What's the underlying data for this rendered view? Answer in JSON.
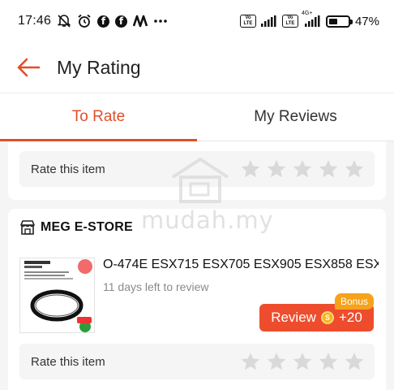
{
  "status_bar": {
    "time": "17:46",
    "battery_pct": "47%",
    "battery_level": 0.47,
    "network_label_1": "Vo LTE",
    "network_label_2": "Vo LTE",
    "network_type": "4G+",
    "icons": [
      "mute-icon",
      "alarm-icon",
      "facebook-icon",
      "facebook-icon",
      "app-icon",
      "more-dots-icon"
    ]
  },
  "header": {
    "title": "My Rating",
    "back_icon": "arrow-left-icon"
  },
  "tabs": [
    {
      "label": "To Rate",
      "active": true
    },
    {
      "label": "My Reviews",
      "active": false
    }
  ],
  "items": [
    {
      "rate_label": "Rate this item",
      "stars": 5
    }
  ],
  "store": {
    "name": "MEG E-STORE",
    "product_name": "O-474E ESX715 ESX705 ESX905 ESX858 ESX",
    "days_left": "11 days left to review",
    "bonus_label": "Bonus",
    "review_label": "Review",
    "reward": "+20",
    "rate_label": "Rate this item",
    "thumb_caption_1": "Washing Machine V Belt/",
    "thumb_caption_2": "Belting",
    "thumb_brand": "Sharp"
  },
  "watermark": {
    "text": "mudah.my"
  },
  "colors": {
    "accent": "#ee4d2d",
    "tab_active": "#e04f2a",
    "bonus": "#f7a21b",
    "star": "#d9d9d9"
  }
}
